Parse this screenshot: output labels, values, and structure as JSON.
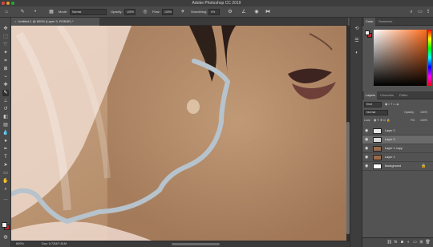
{
  "window": {
    "title": "Adobe Photoshop CC 2019"
  },
  "options_bar": {
    "mode_label": "Mode:",
    "mode_value": "Normal",
    "opacity_label": "Opacity:",
    "opacity_value": "100%",
    "flow_label": "Flow:",
    "flow_value": "100%",
    "smoothing_label": "Smoothing:",
    "smoothing_value": "0%"
  },
  "document": {
    "tab_title": "Untitled-1 @ 600% (Layer 3, RGB/8*) *",
    "close_glyph": "×"
  },
  "status": {
    "zoom": "600%",
    "doc_size": "Doc: 5.72M/7.81M"
  },
  "color_panel": {
    "tabs": [
      "Color",
      "Swatches"
    ]
  },
  "layers_panel": {
    "tabs": [
      "Layers",
      "Channels",
      "Paths"
    ],
    "kind_filter": "Kind",
    "blend_mode": "Normal",
    "opacity_label": "Opacity:",
    "opacity_value": "100%",
    "lock_label": "Lock:",
    "fill_label": "Fill:",
    "fill_value": "100%",
    "layers": [
      {
        "name": "Layer 2",
        "selected": false,
        "thumb_color": "#e8e8e8",
        "locked": false
      },
      {
        "name": "Layer 3",
        "selected": true,
        "thumb_color": "#dcdcdc",
        "locked": false
      },
      {
        "name": "Layer 1 copy",
        "selected": false,
        "thumb_color": "#9a6a4a",
        "locked": false
      },
      {
        "name": "Layer 1",
        "selected": false,
        "thumb_color": "#9a6a4a",
        "locked": false
      },
      {
        "name": "Background",
        "selected": false,
        "thumb_color": "#ffffff",
        "locked": true
      }
    ]
  },
  "colors": {
    "foreground": "#f0f0f0",
    "background": "#c1272d",
    "brush_stroke": "#b7c3cc"
  }
}
